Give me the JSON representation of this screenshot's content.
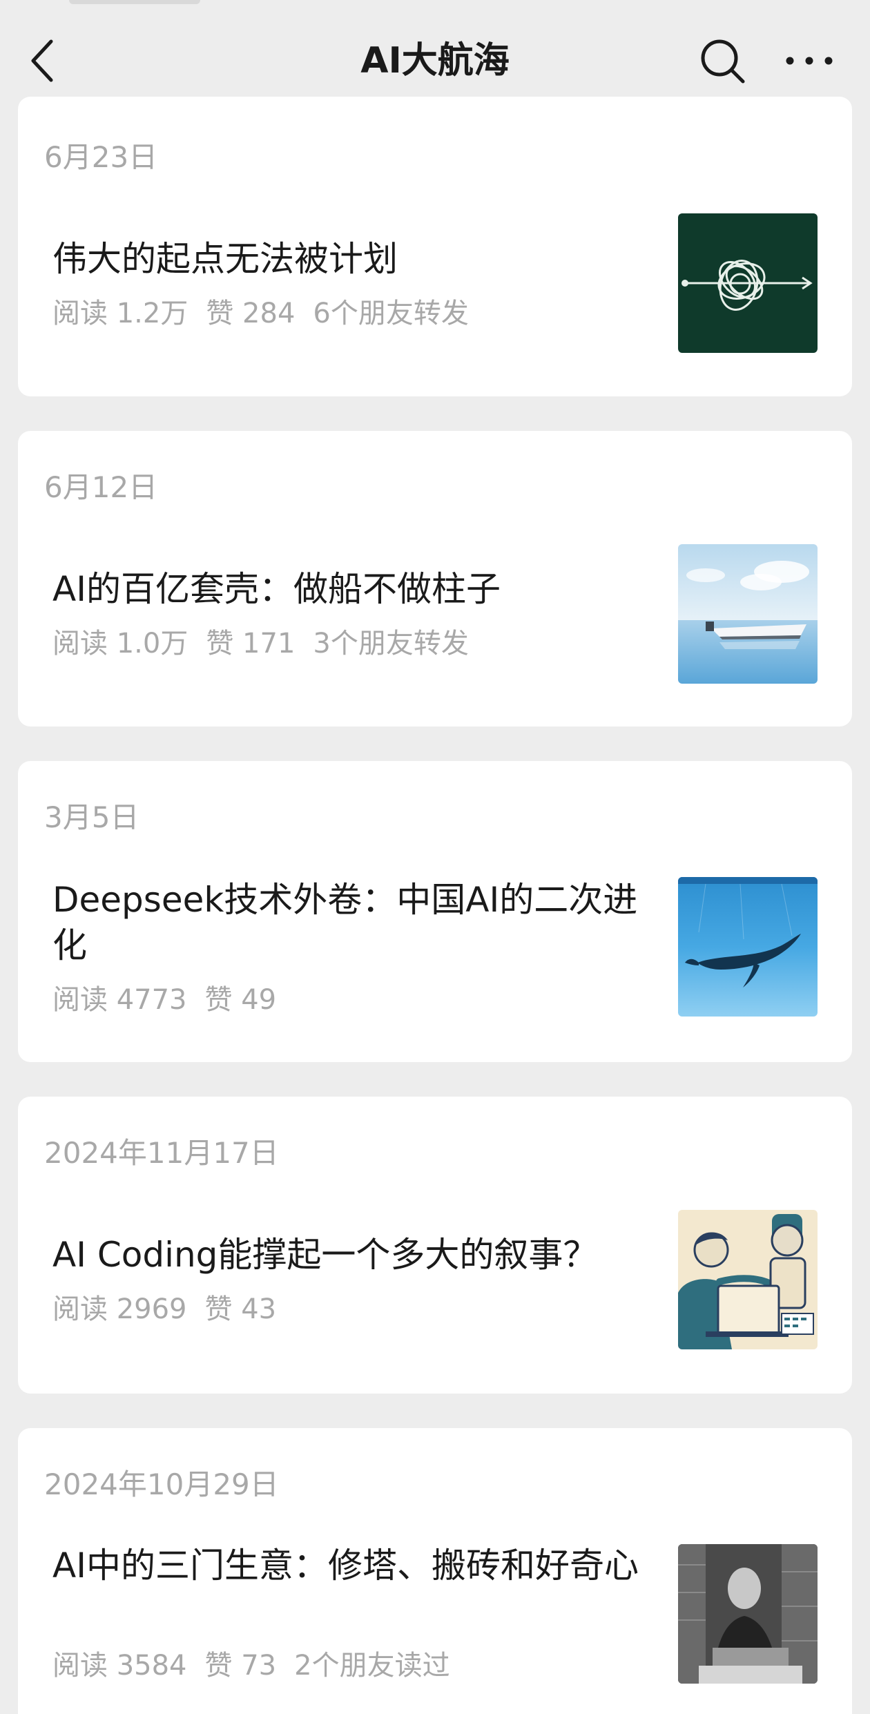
{
  "nav": {
    "title": "AI大航海",
    "back_icon": "back-chevron-icon",
    "search_icon": "search-icon",
    "more_icon": "more-dots-icon"
  },
  "articles": [
    {
      "date": "6月23日",
      "title": "伟大的起点无法被计划",
      "reads": "阅读 1.2万",
      "likes": "赞 284",
      "social": "6个朋友转发",
      "thumb": "tangled-line-thumbnail"
    },
    {
      "date": "6月12日",
      "title": "AI的百亿套壳：做船不做柱子",
      "reads": "阅读 1.0万",
      "likes": "赞 171",
      "social": "3个朋友转发",
      "thumb": "boat-on-sea-thumbnail"
    },
    {
      "date": "3月5日",
      "title": "Deepseek技术外卷：中国AI的二次进化",
      "reads": "阅读 4773",
      "likes": "赞 49",
      "social": "",
      "thumb": "whale-underwater-thumbnail"
    },
    {
      "date": "2024年11月17日",
      "title": "AI Coding能撑起一个多大的叙事？",
      "reads": "阅读 2969",
      "likes": "赞 43",
      "social": "",
      "thumb": "person-and-robot-thumbnail"
    },
    {
      "date": "2024年10月29日",
      "title": "AI中的三门生意：修塔、搬砖和好奇心",
      "reads": "阅读 3584",
      "likes": "赞 73",
      "social": "2个朋友读过",
      "thumb": "craftsman-photo-thumbnail"
    }
  ],
  "colors": {
    "background": "#ededed",
    "card": "#ffffff",
    "title_text": "#1a1a1a",
    "meta_text": "#a8a8a8"
  }
}
